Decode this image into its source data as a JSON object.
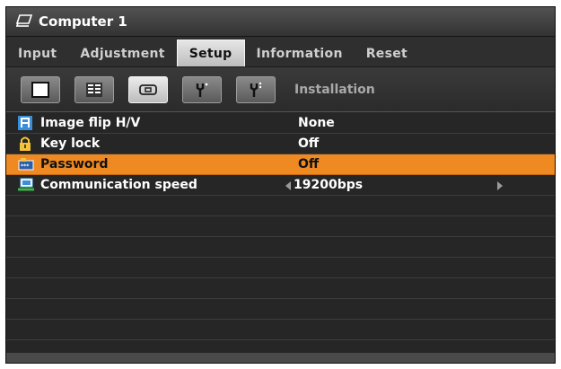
{
  "window": {
    "title": "Computer 1",
    "title_icon": "monitor-icon"
  },
  "tabs": [
    {
      "label": "Input",
      "active": false
    },
    {
      "label": "Adjustment",
      "active": false
    },
    {
      "label": "Setup",
      "active": true
    },
    {
      "label": "Information",
      "active": false
    },
    {
      "label": "Reset",
      "active": false
    }
  ],
  "subtabs": {
    "current_label": "Installation",
    "icons": [
      "general-icon",
      "menu-icon",
      "installation-icon",
      "options1-icon",
      "options2-icon"
    ],
    "selected_index": 2
  },
  "items": [
    {
      "label": "Image flip H/V",
      "value": "None",
      "icon": "flip-icon"
    },
    {
      "label": "Key lock",
      "value": "Off",
      "icon": "lock-icon"
    },
    {
      "label": "Password",
      "value": "Off",
      "icon": "password-icon",
      "selected": true
    },
    {
      "label": "Communication speed",
      "value": "19200bps",
      "icon": "communication-icon",
      "stepper": true
    }
  ],
  "colors": {
    "highlight": "#ef8a22",
    "panel": "#262626"
  }
}
